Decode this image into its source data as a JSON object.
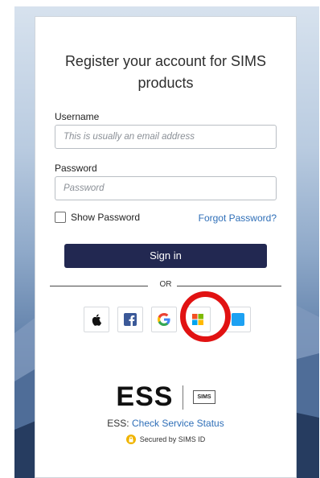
{
  "title": "Register your account for SIMS products",
  "form": {
    "username_label": "Username",
    "username_placeholder": "This is usually an email address",
    "password_label": "Password",
    "password_placeholder": "Password",
    "show_password_label": "Show Password",
    "forgot_password_link": "Forgot Password?",
    "sign_in_button": "Sign in"
  },
  "divider_text": "OR",
  "social_providers": [
    "apple-icon",
    "facebook-icon",
    "google-icon",
    "microsoft-icon",
    "twitter-icon"
  ],
  "footer": {
    "brand_ess": "ESS",
    "brand_sims": "SIMS",
    "status_prefix": "ESS: ",
    "status_link": "Check Service Status",
    "secured_text": "Secured by SIMS ID"
  },
  "colors": {
    "primary_button": "#222851",
    "link": "#2f6fb8",
    "highlight_ring": "#e11212"
  }
}
